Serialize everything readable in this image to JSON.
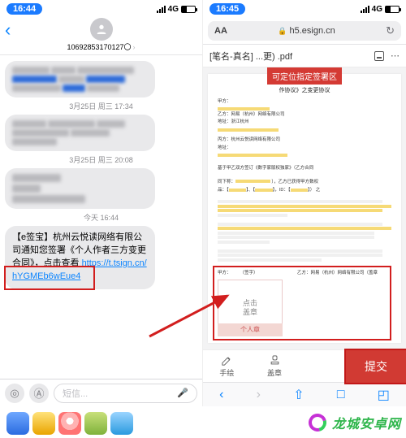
{
  "status": {
    "time_left": "16:44",
    "time_right": "16:45",
    "net": "4G"
  },
  "messages": {
    "sender": "10692853170127〇",
    "ts1": "3月25日 周三 17:34",
    "ts2": "3月25日 周三 20:08",
    "ts3": "今天 16:44",
    "sms_text": "【e签宝】杭州云悦读网络有限公司通知您签署《个人作者三方变更合同》，点击查看",
    "sms_link": "https://t.tsign.cn/hYGMEb6wEue4",
    "placeholder": "短信..."
  },
  "safari": {
    "aa": "AA",
    "url": "h5.esign.cn",
    "doc_title": "[笔名-真名] ...更) .pdf"
  },
  "doc": {
    "tag": "可定位指定签署区",
    "title_suffix": "作协议》之变更协议",
    "partyB": "乙方：网易（杭州）网络有限公司",
    "partyB_addr": "地址：浙江杭州",
    "partyC": "丙方：杭州云悦读网络有限公司",
    "partyC_addr": "地址：",
    "sig_hint_l1": "点击",
    "sig_hint_l2": "盖章",
    "sig_tab": "个人章",
    "right_party": "网易（杭州）网络有限公司（盖章"
  },
  "actions": {
    "draw": "手绘",
    "stamp": "盖章",
    "submit": "提交"
  },
  "watermark": "龙城安卓网"
}
